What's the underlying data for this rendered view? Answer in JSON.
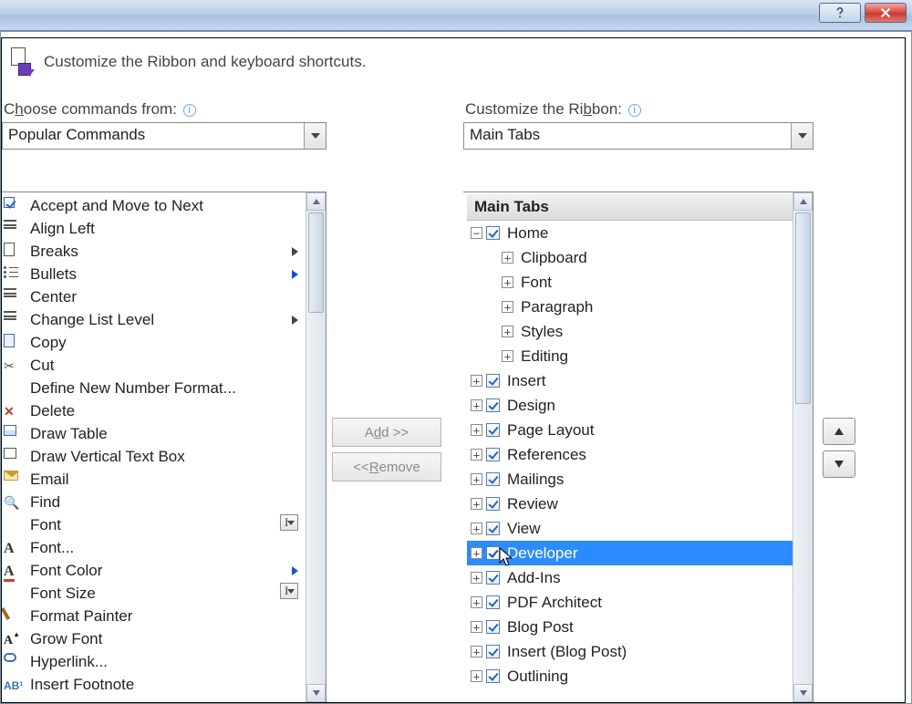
{
  "titlebar": {
    "help_tooltip": "Help",
    "close_tooltip": "Close"
  },
  "intro": "Customize the Ribbon and keyboard shortcuts.",
  "left": {
    "label_pre": "C",
    "label_u": "h",
    "label_post": "oose commands from:",
    "combo": "Popular Commands",
    "items": [
      {
        "label": "Accept and Move to Next",
        "icon": "check",
        "sub": null
      },
      {
        "label": "Align Left",
        "icon": "lines",
        "sub": null
      },
      {
        "label": "Breaks",
        "icon": "page",
        "sub": "tri"
      },
      {
        "label": "Bullets",
        "icon": "bullets",
        "sub": "tri-blue"
      },
      {
        "label": "Center",
        "icon": "center",
        "sub": null
      },
      {
        "label": "Change List Level",
        "icon": "list",
        "sub": "tri"
      },
      {
        "label": "Copy",
        "icon": "page2",
        "sub": null
      },
      {
        "label": "Cut",
        "icon": "scis",
        "sub": null
      },
      {
        "label": "Define New Number Format...",
        "icon": "",
        "sub": null
      },
      {
        "label": "Delete",
        "icon": "x",
        "sub": null
      },
      {
        "label": "Draw Table",
        "icon": "table",
        "sub": null
      },
      {
        "label": "Draw Vertical Text Box",
        "icon": "textbox",
        "sub": null
      },
      {
        "label": "Email",
        "icon": "mail",
        "sub": null
      },
      {
        "label": "Find",
        "icon": "bino",
        "sub": null
      },
      {
        "label": "Font",
        "icon": "",
        "sub": "box-ibar"
      },
      {
        "label": "Font...",
        "icon": "A",
        "sub": null
      },
      {
        "label": "Font Color",
        "icon": "Acolor",
        "sub": "tri-blue"
      },
      {
        "label": "Font Size",
        "icon": "",
        "sub": "box-ibar"
      },
      {
        "label": "Format Painter",
        "icon": "brush",
        "sub": null
      },
      {
        "label": "Grow Font",
        "icon": "grow",
        "sub": null
      },
      {
        "label": "Hyperlink...",
        "icon": "link",
        "sub": null
      },
      {
        "label": "Insert Footnote",
        "icon": "ab",
        "sub": null
      }
    ]
  },
  "right": {
    "label_pre": "Customize the Ri",
    "label_u": "b",
    "label_post": "bon:",
    "combo": "Main Tabs",
    "header": "Main Tabs",
    "tree": [
      {
        "expand": "minus",
        "depth": 0,
        "checked": true,
        "label": "Home",
        "sel": false
      },
      {
        "expand": "plus",
        "depth": 1,
        "checked": null,
        "label": "Clipboard",
        "sel": false
      },
      {
        "expand": "plus",
        "depth": 1,
        "checked": null,
        "label": "Font",
        "sel": false
      },
      {
        "expand": "plus",
        "depth": 1,
        "checked": null,
        "label": "Paragraph",
        "sel": false
      },
      {
        "expand": "plus",
        "depth": 1,
        "checked": null,
        "label": "Styles",
        "sel": false
      },
      {
        "expand": "plus",
        "depth": 1,
        "checked": null,
        "label": "Editing",
        "sel": false
      },
      {
        "expand": "plus",
        "depth": 0,
        "checked": true,
        "label": "Insert",
        "sel": false
      },
      {
        "expand": "plus",
        "depth": 0,
        "checked": true,
        "label": "Design",
        "sel": false
      },
      {
        "expand": "plus",
        "depth": 0,
        "checked": true,
        "label": "Page Layout",
        "sel": false
      },
      {
        "expand": "plus",
        "depth": 0,
        "checked": true,
        "label": "References",
        "sel": false
      },
      {
        "expand": "plus",
        "depth": 0,
        "checked": true,
        "label": "Mailings",
        "sel": false
      },
      {
        "expand": "plus",
        "depth": 0,
        "checked": true,
        "label": "Review",
        "sel": false
      },
      {
        "expand": "plus",
        "depth": 0,
        "checked": true,
        "label": "View",
        "sel": false
      },
      {
        "expand": "plus",
        "depth": 0,
        "checked": true,
        "label": "Developer",
        "sel": true
      },
      {
        "expand": "plus",
        "depth": 0,
        "checked": true,
        "label": "Add-Ins",
        "sel": false
      },
      {
        "expand": "plus",
        "depth": 0,
        "checked": true,
        "label": "PDF Architect",
        "sel": false
      },
      {
        "expand": "plus",
        "depth": 0,
        "checked": true,
        "label": "Blog Post",
        "sel": false
      },
      {
        "expand": "plus",
        "depth": 0,
        "checked": true,
        "label": "Insert (Blog Post)",
        "sel": false
      },
      {
        "expand": "plus",
        "depth": 0,
        "checked": true,
        "label": "Outlining",
        "sel": false
      }
    ]
  },
  "mid": {
    "add_pre": "A",
    "add_u": "d",
    "add_post": "d >>",
    "rem_pre": "<< ",
    "rem_u": "R",
    "rem_post": "emove"
  }
}
